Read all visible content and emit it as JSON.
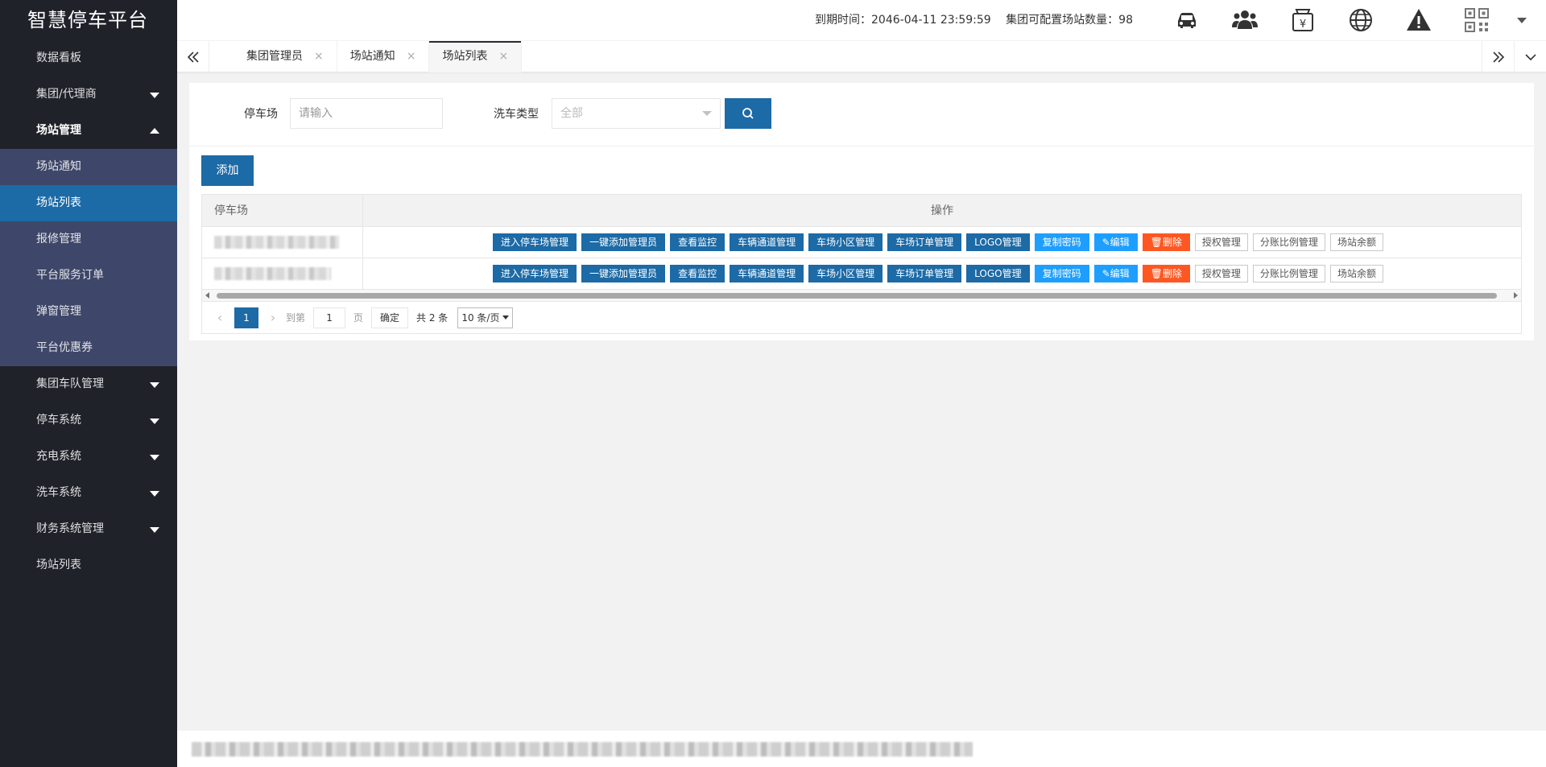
{
  "app": {
    "title": "智慧停车平台"
  },
  "sidebar": {
    "items": [
      {
        "label": "数据看板"
      },
      {
        "label": "集团/代理商"
      },
      {
        "label": "场站管理"
      },
      {
        "label": "集团车队管理"
      },
      {
        "label": "停车系统"
      },
      {
        "label": "充电系统"
      },
      {
        "label": "洗车系统"
      },
      {
        "label": "财务系统管理"
      },
      {
        "label": "场站列表"
      }
    ],
    "subitems": [
      {
        "label": "场站通知"
      },
      {
        "label": "场站列表"
      },
      {
        "label": "报修管理"
      },
      {
        "label": "平台服务订单"
      },
      {
        "label": "弹窗管理"
      },
      {
        "label": "平台优惠券"
      }
    ]
  },
  "header": {
    "expire_label": "到期时间：",
    "expire_value": "2046-04-11 23:59:59",
    "station_label": "集团可配置场站数量：",
    "station_value": "98",
    "icons": [
      "car-icon",
      "users-icon",
      "wallet-icon",
      "globe-icon",
      "warning-icon",
      "qrcode-icon",
      "chevron-down-icon"
    ]
  },
  "tabs": [
    {
      "label": "集团管理员",
      "close": "×"
    },
    {
      "label": "场站通知",
      "close": "×"
    },
    {
      "label": "场站列表",
      "close": "×"
    }
  ],
  "search": {
    "parking_label": "停车场",
    "parking_placeholder": "请输入",
    "wash_label": "洗车类型",
    "wash_value": "全部"
  },
  "toolbar": {
    "add_label": "添加"
  },
  "table": {
    "columns": [
      "停车场",
      "操作"
    ],
    "actions": [
      {
        "label": "进入停车场管理",
        "style": "primary"
      },
      {
        "label": "一键添加管理员",
        "style": "primary"
      },
      {
        "label": "查看监控",
        "style": "primary"
      },
      {
        "label": "车辆通道管理",
        "style": "primary"
      },
      {
        "label": "车场小区管理",
        "style": "primary"
      },
      {
        "label": "车场订单管理",
        "style": "primary"
      },
      {
        "label": "LOGO管理",
        "style": "primary"
      },
      {
        "label": "复制密码",
        "style": "light"
      },
      {
        "label": "✎编辑",
        "style": "light"
      },
      {
        "label": "🗑删除",
        "style": "danger"
      },
      {
        "label": "授权管理",
        "style": "plain"
      },
      {
        "label": "分账比例管理",
        "style": "plain"
      },
      {
        "label": "场站余额",
        "style": "plain"
      }
    ],
    "row_count": 2
  },
  "pagination": {
    "prev": "‹",
    "current": "1",
    "next": "›",
    "goto_label": "到第",
    "goto_value": "1",
    "page_label": "页",
    "confirm_label": "确定",
    "total_label": "共 2 条",
    "page_size": "10 条/页"
  },
  "colors": {
    "sidebar_bg": "#20222a",
    "submenu_bg": "#3e4769",
    "primary": "#1c6aa6",
    "light": "#1e9fff",
    "danger": "#ff5722"
  }
}
